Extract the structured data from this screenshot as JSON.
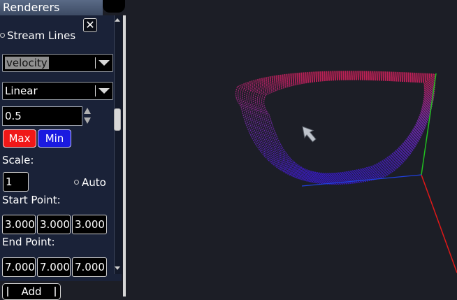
{
  "panel": {
    "title": "Renderers",
    "stream_lines_label": "Stream Lines",
    "field_dropdown": {
      "selected": "velocity"
    },
    "interp_dropdown": {
      "selected": "Linear"
    },
    "value_input": {
      "value": "0.5"
    },
    "max_label": "Max",
    "min_label": "Min",
    "scale_label": "Scale:",
    "scale_value": "1",
    "auto_label": "Auto",
    "start_point_label": "Start Point:",
    "start_point": [
      "3.000",
      "3.000",
      "3.000"
    ],
    "end_point_label": "End Point:",
    "end_point": [
      "7.000",
      "7.000",
      "7.000"
    ],
    "add_label": "Add",
    "close_icon": "close-icon"
  },
  "colors": {
    "background": "#1c1e26",
    "panel": "#1a2238",
    "max_button": "#f01818",
    "min_button": "#1a1ae0",
    "streamline_top": "#d0205a",
    "streamline_bottom": "#3a1ad8"
  },
  "viewport": {
    "axes": [
      "x-axis-red",
      "y-axis-green",
      "z-axis-blue"
    ],
    "cursor_icon": "arrow-cursor-icon"
  }
}
